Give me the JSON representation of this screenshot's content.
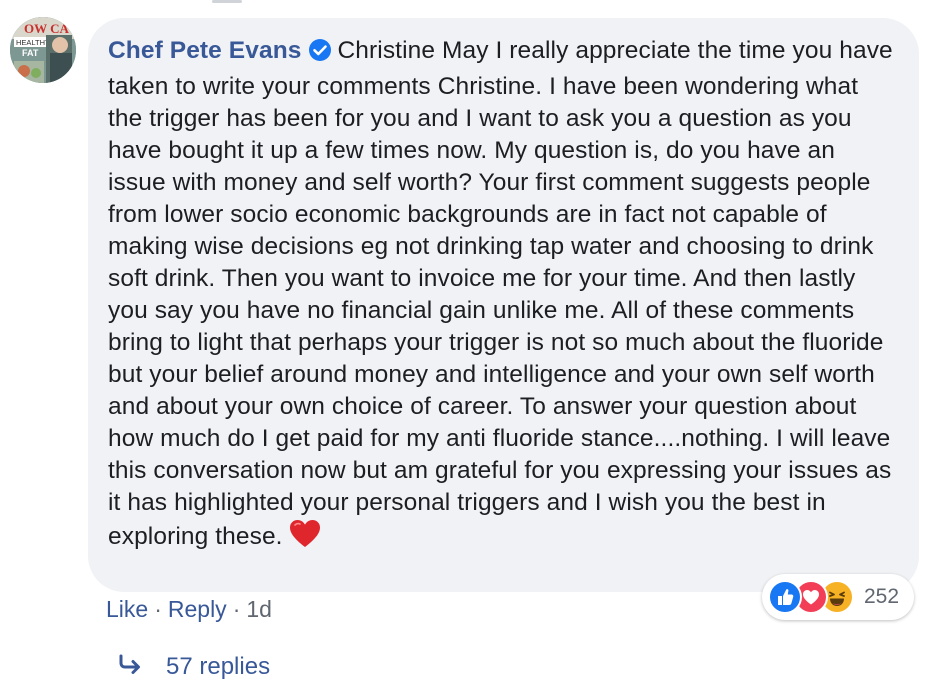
{
  "comment": {
    "author": "Chef Pete Evans",
    "tagged_name": "Christine May",
    "text": " I really appreciate the time you have taken to write your comments Christine. I have been wondering what the trigger has been for you and I want to ask you a question as you have bought it up a few times now. My question is, do you have an issue with money and self worth? Your first comment suggests people from lower socio economic backgrounds are in fact not capable of making wise decisions eg not drinking tap water and choosing to drink soft drink. Then you want to invoice me for your time. And then lastly you say you have no financial gain unlike me. All of these comments bring to light that perhaps your trigger is not so much about the fluoride but your belief around money and intelligence and your own self worth and about your own choice of career. To answer your question about how much do I get paid for my anti fluoride stance....nothing. I will leave this conversation now but am grateful for you expressing your issues as it has highlighted your personal triggers and I wish you the best in exploring these.",
    "trailing_emoji": "heart-emoji",
    "avatar_lettering": [
      "LOW CARB",
      "HEALTHY",
      "FAT"
    ]
  },
  "reactions": {
    "icons": [
      "like-icon",
      "love-icon",
      "haha-icon"
    ],
    "count": "252"
  },
  "actions": {
    "like_label": "Like",
    "reply_label": "Reply",
    "separator": "·",
    "timestamp": "1d"
  },
  "replies": {
    "label": "57 replies"
  },
  "colors": {
    "link": "#385898",
    "bubble": "#f0f2f5",
    "text": "#1c1e21",
    "meta": "#606770",
    "like": "#1877f2",
    "love": "#f33e58",
    "haha": "#f7b125",
    "verified": "#1877f2"
  }
}
